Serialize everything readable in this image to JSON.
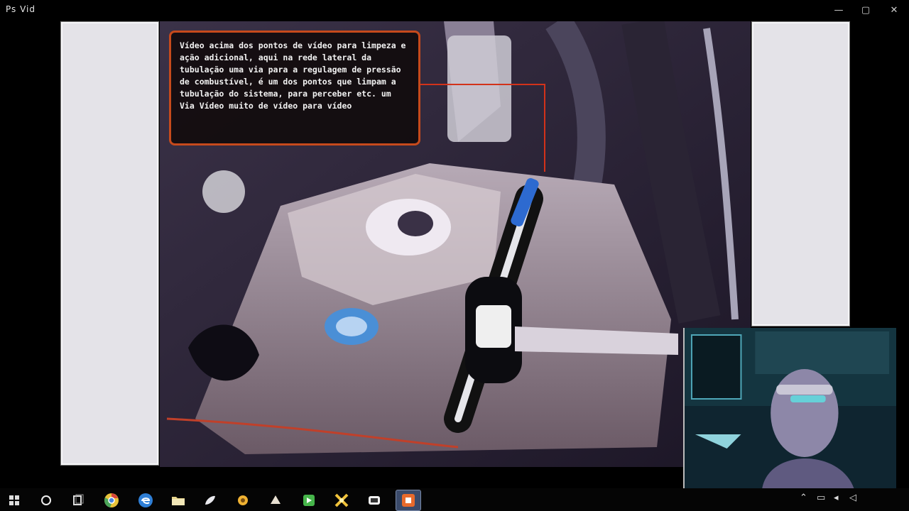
{
  "window": {
    "title": "Ps Vid",
    "controls": {
      "minimize": "—",
      "maximize": "▢",
      "close": "✕"
    }
  },
  "overlay": {
    "caption": "Vídeo acima dos pontos de vídeo para limpeza e ação adicional, aqui na rede lateral da tubulação uma via para a regulagem de pressão de combustível, é um dos pontos que limpam a tubulação do sistema, para perceber etc. um Via Vídeo muito de vídeo para vídeo",
    "accent_color": "#c64a1c"
  },
  "taskbar": {
    "icons": [
      {
        "id": "start",
        "icon": "windows-icon"
      },
      {
        "id": "search",
        "icon": "cortana-icon"
      },
      {
        "id": "task",
        "icon": "task-view-icon"
      },
      {
        "id": "chrome",
        "icon": "chrome-icon"
      },
      {
        "id": "edge",
        "icon": "edge-icon"
      },
      {
        "id": "files",
        "icon": "file-explorer-icon"
      },
      {
        "id": "app1",
        "icon": "app-icon"
      },
      {
        "id": "app2",
        "icon": "app-icon"
      },
      {
        "id": "app3",
        "icon": "app-icon"
      },
      {
        "id": "app4",
        "icon": "app-icon"
      },
      {
        "id": "app5",
        "icon": "app-icon"
      },
      {
        "id": "app6",
        "icon": "app-icon"
      },
      {
        "id": "app7",
        "icon": "active-app-icon"
      }
    ],
    "tray": {
      "clock": ""
    }
  }
}
